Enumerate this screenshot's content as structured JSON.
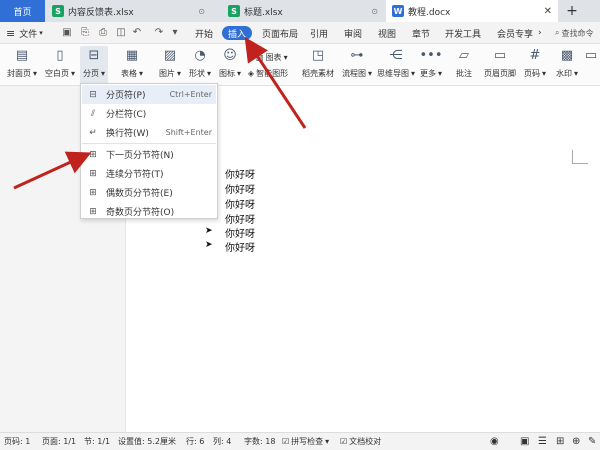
{
  "tabs": {
    "home": "首页",
    "xlsx1": "内容反馈表.xlsx",
    "xlsx2": "标题.xlsx",
    "docx": "教程.docx"
  },
  "menu": {
    "file": "文件",
    "items": [
      "开始",
      "插入",
      "页面布局",
      "引用",
      "审阅",
      "视图",
      "章节",
      "开发工具",
      "会员专享"
    ],
    "search": "查找命令"
  },
  "ribbon": {
    "cover": "封面页",
    "blank": "空白页",
    "pagebreak": "分页",
    "table": "表格",
    "image": "图片",
    "shape": "形状",
    "icon": "图标",
    "smart": "智能图形",
    "chart": "图表",
    "material": "稻壳素材",
    "flow": "流程图",
    "mindmap": "思维导图",
    "more": "更多",
    "comment": "批注",
    "headerfooter": "页眉页脚",
    "pagenum": "页码",
    "watermark": "水印"
  },
  "dropdown": {
    "items": [
      {
        "label": "分页符(P)",
        "shortcut": "Ctrl+Enter"
      },
      {
        "label": "分栏符(C)",
        "shortcut": ""
      },
      {
        "label": "换行符(W)",
        "shortcut": "Shift+Enter"
      },
      {
        "label": "下一页分节符(N)",
        "shortcut": ""
      },
      {
        "label": "连续分节符(T)",
        "shortcut": ""
      },
      {
        "label": "偶数页分节符(E)",
        "shortcut": ""
      },
      {
        "label": "奇数页分节符(O)",
        "shortcut": ""
      }
    ]
  },
  "document": {
    "lines": [
      "你好呀",
      "你好呀",
      "你好呀",
      "你好呀",
      "你好呀",
      "你好呀"
    ],
    "bullets": [
      "➤",
      "➤"
    ]
  },
  "status": {
    "page": "页码: 1",
    "pages": "页面: 1/1",
    "section": "节: 1/1",
    "setting": "设置值: 5.2厘米",
    "row": "行: 6",
    "col": "列: 4",
    "words": "字数: 18",
    "spell": "拼写检查",
    "proof": "文档校对"
  },
  "colors": {
    "accent": "#2f6fd6",
    "arrow": "#c0231d"
  }
}
